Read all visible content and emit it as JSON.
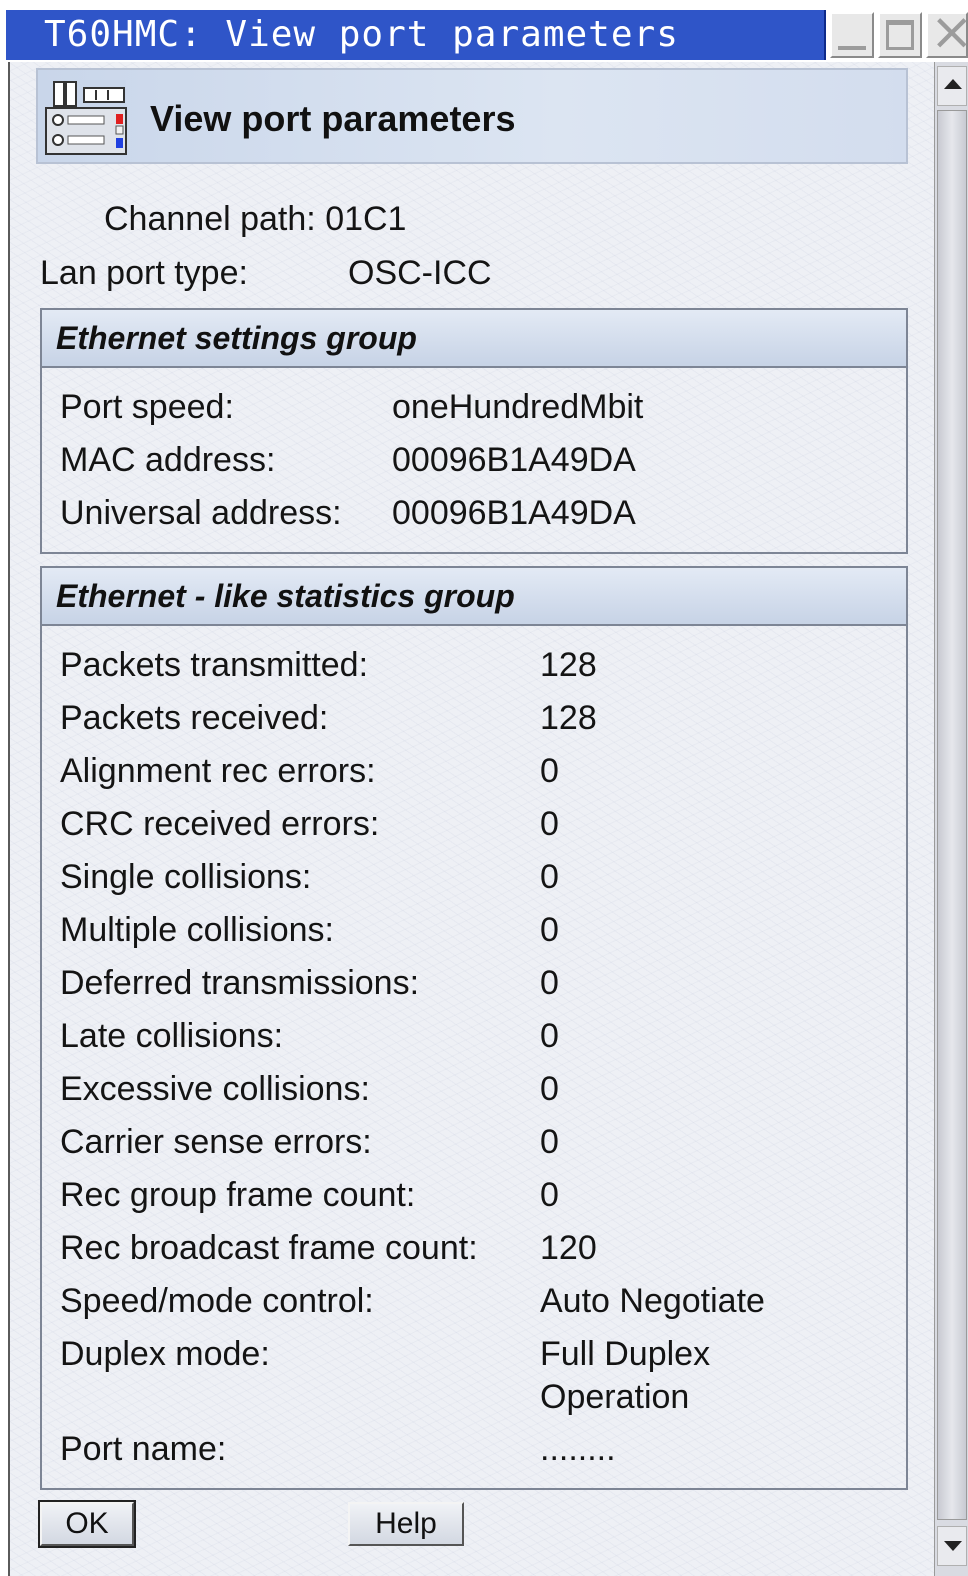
{
  "window": {
    "title": "T60HMC: View port parameters",
    "title_bar_color": "#2f55c8"
  },
  "header": {
    "title": "View port parameters",
    "icon": "port-hardware-icon"
  },
  "channel_path": {
    "label": "Channel path:",
    "value": "01C1"
  },
  "lan_port_type": {
    "label": "Lan port type:",
    "value": "OSC-ICC"
  },
  "ethernet_settings": {
    "title": "Ethernet settings group",
    "rows": [
      {
        "label": "Port speed:",
        "value": "oneHundredMbit"
      },
      {
        "label": "MAC address:",
        "value": "00096B1A49DA"
      },
      {
        "label": "Universal address:",
        "value": "00096B1A49DA"
      }
    ]
  },
  "ethernet_statistics": {
    "title": "Ethernet - like statistics group",
    "rows": [
      {
        "label": "Packets transmitted:",
        "value": "128"
      },
      {
        "label": "Packets received:",
        "value": "128"
      },
      {
        "label": "Alignment rec errors:",
        "value": "0"
      },
      {
        "label": "CRC received errors:",
        "value": "0"
      },
      {
        "label": "Single collisions:",
        "value": "0"
      },
      {
        "label": "Multiple collisions:",
        "value": "0"
      },
      {
        "label": "Deferred transmissions:",
        "value": "0"
      },
      {
        "label": "Late collisions:",
        "value": "0"
      },
      {
        "label": "Excessive collisions:",
        "value": "0"
      },
      {
        "label": "Carrier sense errors:",
        "value": "0"
      },
      {
        "label": "Rec group frame count:",
        "value": "0"
      },
      {
        "label": "Rec broadcast frame count:",
        "value": "120"
      },
      {
        "label": "Speed/mode control:",
        "value": "Auto Negotiate"
      },
      {
        "label": "Duplex mode:",
        "value": "Full Duplex",
        "value_line2": "Operation"
      },
      {
        "label": "Port name:",
        "value": "........"
      }
    ]
  },
  "buttons": {
    "ok": "OK",
    "help": "Help"
  }
}
